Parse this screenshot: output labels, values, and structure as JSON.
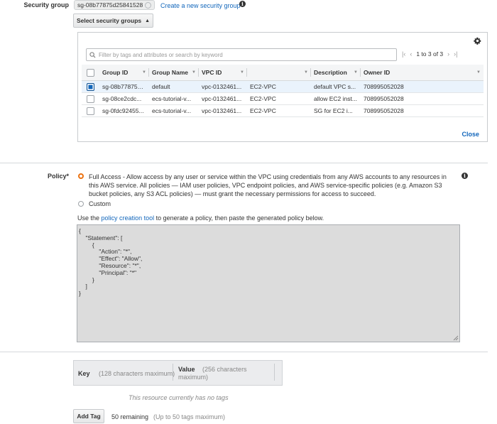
{
  "security_group": {
    "label": "Security group",
    "token": "sg-08b77875d25841528",
    "create_link": "Create a new security group",
    "select_button": "Select security groups"
  },
  "sg_panel": {
    "search_placeholder": "Filter by tags and attributes or search by keyword",
    "pagination": "1 to 3 of 3",
    "columns": [
      "Group ID",
      "Group Name",
      "VPC ID",
      "",
      "Description",
      "Owner ID"
    ],
    "rows": [
      {
        "selected": true,
        "cells": [
          "sg-08b77875d25841528",
          "default",
          "vpc-0132461...",
          "EC2-VPC",
          "default VPC s...",
          "708995052028"
        ]
      },
      {
        "selected": false,
        "cells": [
          "sg-08ce2cdc...",
          "ecs-tutorial-v...",
          "vpc-0132461...",
          "EC2-VPC",
          "allow EC2 inst...",
          "708995052028"
        ]
      },
      {
        "selected": false,
        "cells": [
          "sg-0fdc92455...",
          "ecs-tutorial-v...",
          "vpc-0132461...",
          "EC2-VPC",
          "SG for EC2 i...",
          "708995052028"
        ]
      }
    ],
    "close": "Close"
  },
  "policy": {
    "label": "Policy*",
    "full_access_text": "Full Access - Allow access by any user or service within the VPC using credentials from any AWS accounts to any resources in this AWS service. All policies — IAM user policies, VPC endpoint policies, and AWS service-specific policies (e.g. Amazon S3 bucket policies, any S3 ACL policies) — must grant the necessary permissions for access to succeed.",
    "custom_label": "Custom",
    "use_text_before": "Use the",
    "tool_link": "policy creation tool",
    "use_text_after": "to generate a policy, then paste the generated policy below.",
    "document": "{\n    \"Statement\": [\n        {\n            \"Action\": \"*\",\n            \"Effect\": \"Allow\",\n            \"Resource\": \"*\",\n            \"Principal\": \"*\"\n        }\n    ]\n}"
  },
  "tags": {
    "key_label": "Key",
    "key_hint": "(128 characters maximum)",
    "value_label": "Value",
    "value_hint": "(256 characters maximum)",
    "empty_text": "This resource currently has no tags",
    "add_button": "Add Tag",
    "remaining": "50 remaining",
    "max_hint": "(Up to 50 tags maximum)"
  }
}
